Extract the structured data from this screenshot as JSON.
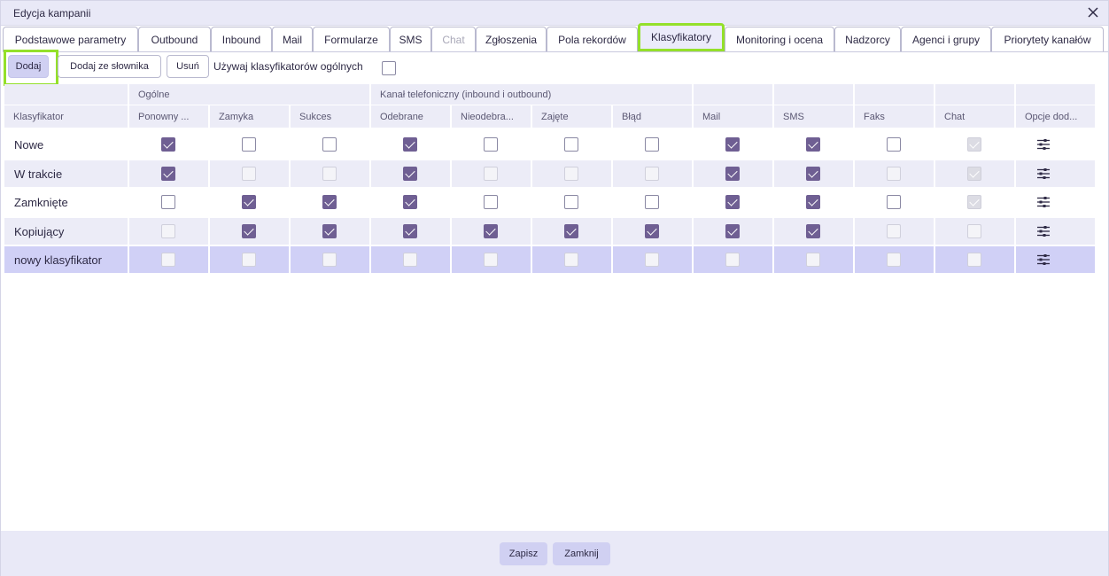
{
  "window": {
    "title": "Edycja kampanii"
  },
  "tabs": [
    {
      "label": "Podstawowe parametry"
    },
    {
      "label": "Outbound"
    },
    {
      "label": "Inbound"
    },
    {
      "label": "Mail"
    },
    {
      "label": "Formularze"
    },
    {
      "label": "SMS"
    },
    {
      "label": "Chat",
      "disabled": true
    },
    {
      "label": "Zgłoszenia"
    },
    {
      "label": "Pola rekordów"
    },
    {
      "label": "Klasyfikatory",
      "active": true
    },
    {
      "label": "Monitoring i ocena"
    },
    {
      "label": "Nadzorcy"
    },
    {
      "label": "Agenci i grupy"
    },
    {
      "label": "Priorytety kanałów"
    }
  ],
  "toolbar": {
    "add_label": "Dodaj",
    "add_from_dict_label": "Dodaj ze słownika",
    "delete_label": "Usuń",
    "use_general_label": "Używaj klasyfikatorów ogólnych",
    "use_general_checked": false
  },
  "table": {
    "group_headers": {
      "general": "Ogólne",
      "phone": "Kanał telefoniczny (inbound i outbound)"
    },
    "columns": [
      "Klasyfikator",
      "Ponowny ...",
      "Zamyka",
      "Sukces",
      "Odebrane",
      "Nieodebra...",
      "Zajęte",
      "Błąd",
      "Mail",
      "SMS",
      "Faks",
      "Chat",
      "Opcje dod..."
    ],
    "rows": [
      {
        "name": "Nowe",
        "cells": [
          "checked",
          "empty",
          "empty",
          "checked",
          "empty",
          "empty",
          "empty",
          "checked",
          "checked",
          "empty",
          "disabled-checked"
        ]
      },
      {
        "name": "W trakcie",
        "cells": [
          "checked",
          "disabled",
          "disabled",
          "checked",
          "disabled",
          "disabled",
          "disabled",
          "checked",
          "checked",
          "disabled",
          "disabled-checked"
        ]
      },
      {
        "name": "Zamknięte",
        "cells": [
          "empty",
          "checked",
          "checked",
          "checked",
          "empty",
          "empty",
          "empty",
          "checked",
          "checked",
          "empty",
          "disabled-checked"
        ]
      },
      {
        "name": "Kopiujący",
        "cells": [
          "disabled",
          "checked",
          "checked",
          "checked",
          "checked",
          "checked",
          "checked",
          "checked",
          "checked",
          "disabled",
          "disabled"
        ]
      },
      {
        "name": "nowy klasyfikator",
        "cells": [
          "disabled",
          "disabled",
          "disabled",
          "disabled",
          "disabled",
          "disabled",
          "disabled",
          "disabled",
          "disabled",
          "disabled",
          "disabled"
        ],
        "selected": true
      }
    ],
    "options_icon": "sliders-icon"
  },
  "footer": {
    "save_label": "Zapisz",
    "close_label": "Zamknij"
  },
  "colors": {
    "accent": "#6f5f93",
    "highlight": "#94e02a",
    "header_bg": "#ececf7",
    "selected_row": "#d0d0f6"
  }
}
